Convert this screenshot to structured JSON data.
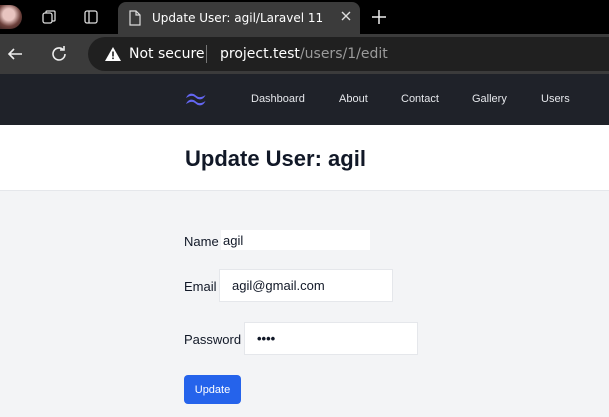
{
  "browser": {
    "tab_title": "Update User: agil/Laravel 11",
    "security_label": "Not secure",
    "url_host": "project.test",
    "url_path": "/users/1/edit"
  },
  "nav": {
    "links": [
      "Dashboard",
      "About",
      "Contact",
      "Gallery",
      "Users"
    ]
  },
  "page": {
    "title": "Update User: agil"
  },
  "form": {
    "name_label": "Name",
    "name_value": "agil",
    "email_label": "Email",
    "email_value": "agil@gmail.com",
    "password_label": "Password",
    "password_value": "••••",
    "submit_label": "Update"
  },
  "colors": {
    "accent": "#2563eb",
    "nav_bg": "#1f2229",
    "logo": "#6366f1"
  }
}
